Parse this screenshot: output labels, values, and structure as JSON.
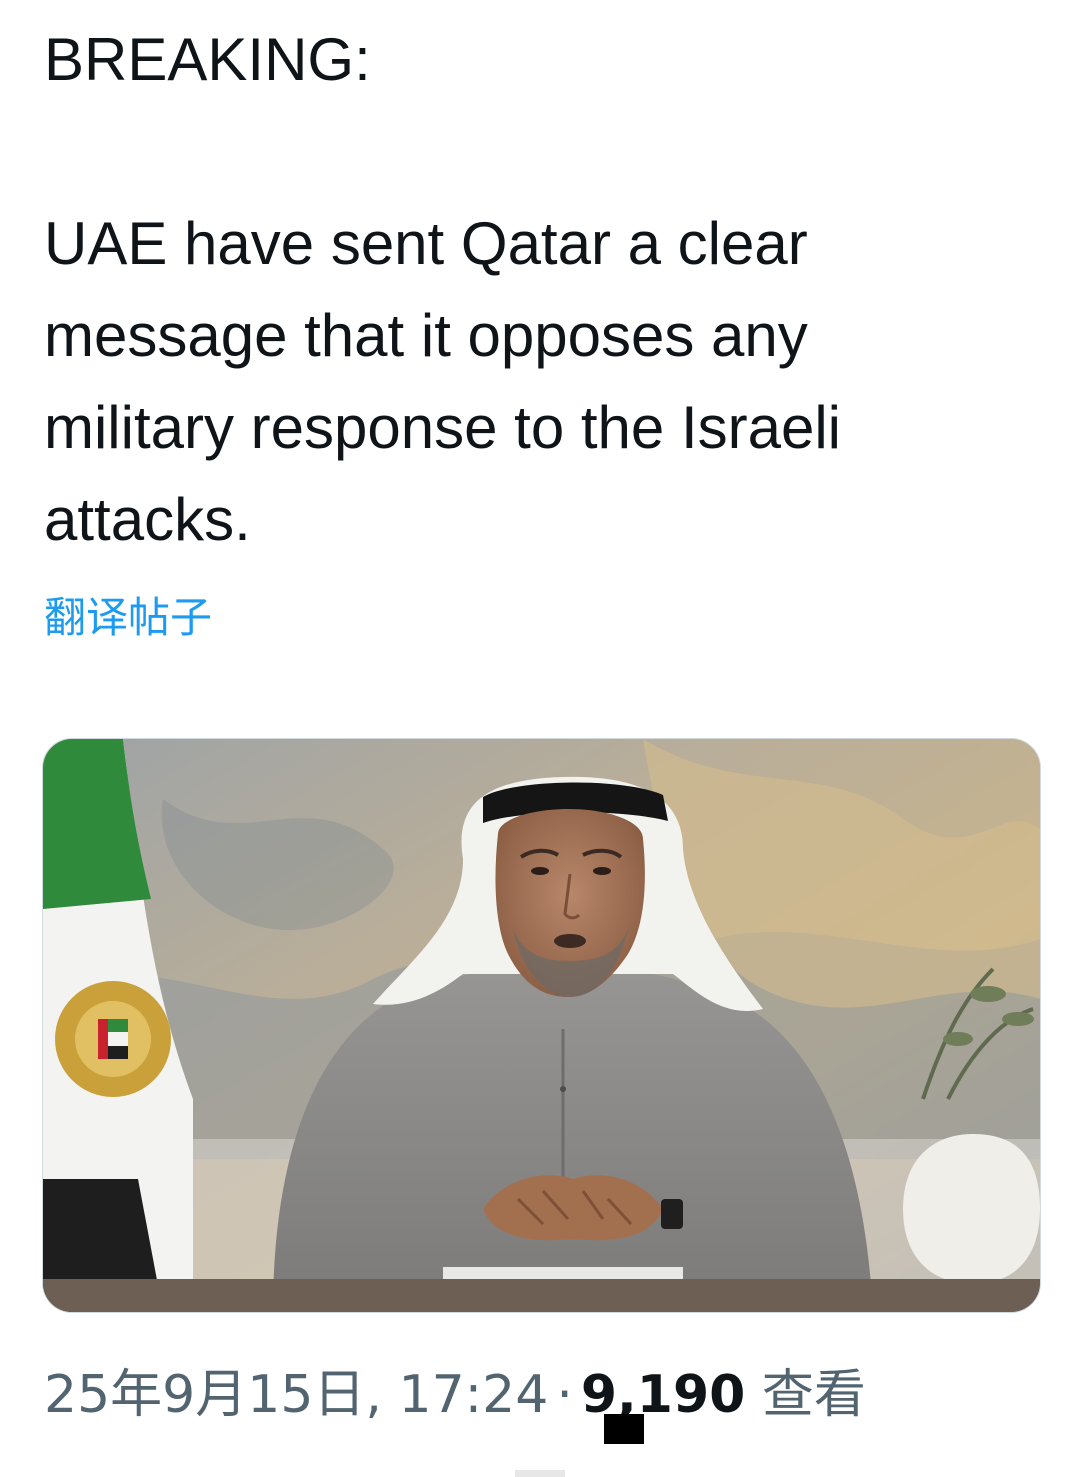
{
  "post": {
    "heading": "BREAKING:",
    "body_lines": [
      "UAE have sent Qatar a clear",
      "message that it opposes any",
      "military response to the Israeli",
      "attacks."
    ],
    "translate_label": "翻译帖子"
  },
  "media": {
    "kind": "photo",
    "subject": "man in grey kandura and white ghutra seated at desk, UAE flag at left",
    "colors": {
      "flag_green": "#2f8a3c",
      "flag_white": "#f3f3f1",
      "flag_black": "#1e1e1e",
      "flag_red": "#c8232c",
      "robe_grey": "#8d8c8a",
      "ghutra_white": "#f2f2ee",
      "agal_black": "#151515",
      "skin": "#a9785a",
      "desk": "#6e5f55",
      "background_painting": "#b7ad9d"
    }
  },
  "meta": {
    "datetime": "25年9月15日, 17:24",
    "separator": "·",
    "views_count": "9,190",
    "views_label": "查看"
  },
  "colors": {
    "text": "#0f1419",
    "link": "#1d9bf0",
    "secondary": "#536471",
    "background": "#ffffff"
  }
}
